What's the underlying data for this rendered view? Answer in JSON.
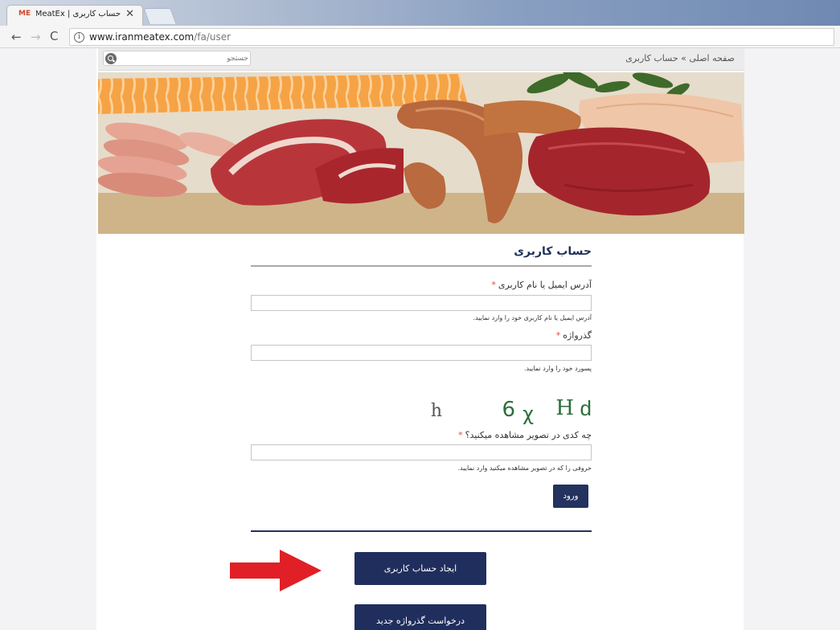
{
  "browser": {
    "tab_favicon_text": "ME",
    "tab_title": "حساب کاربری | MeatEx",
    "tab_close_glyph": "✕",
    "url_host": "www.iranmeatex.com",
    "url_path": "/fa/user"
  },
  "header": {
    "search_placeholder": "جستجو",
    "breadcrumb": "صفحه اصلی » حساب کاربری"
  },
  "form": {
    "title": "حساب کاربری",
    "email_label": "آدرس ایمیل یا نام کاربری",
    "email_value": "",
    "email_hint": "آدرس ایمیل یا نام کاربری خود را وارد نمایید.",
    "password_label": "گذرواژه",
    "password_value": "",
    "password_hint": "پسورد خود را وارد نمایید.",
    "captcha_chars": [
      "h",
      "6",
      "χ",
      "H",
      "d"
    ],
    "captcha_label": "چه کدی در تصویر مشاهده میکنید؟",
    "captcha_value": "",
    "captcha_hint": "حروفی را که در تصویر مشاهده میکنید وارد نمایید.",
    "required_mark": "*",
    "login_label": "ورود"
  },
  "actions": {
    "create_account_label": "ایجاد حساب کاربری",
    "new_password_label": "درخواست گذرواژه جدید"
  },
  "colors": {
    "primary": "#23325e",
    "required": "#d94b4b",
    "arrow": "#e11f26"
  }
}
